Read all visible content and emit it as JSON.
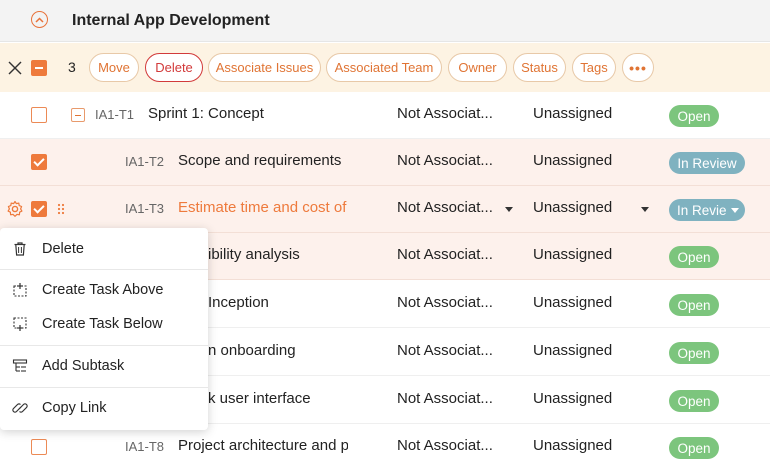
{
  "header": {
    "title": "Internal App Development"
  },
  "toolbar": {
    "selected_count": "3",
    "buttons": {
      "move": "Move",
      "delete": "Delete",
      "associate_issues": "Associate Issues",
      "associated_team": "Associated Team",
      "owner": "Owner",
      "status": "Status",
      "tags": "Tags",
      "more": "•••"
    }
  },
  "rows": [
    {
      "id": "IA1-T1",
      "name": "Sprint 1: Concept",
      "team": "Not Associat...",
      "owner": "Unassigned",
      "status": "Open",
      "checked": false
    },
    {
      "id": "IA1-T2",
      "name": "Scope and requirements i",
      "team": "Not Associat...",
      "owner": "Unassigned",
      "status": "In Review",
      "checked": true
    },
    {
      "id": "IA1-T3",
      "name": "Estimate time and cost of",
      "team": "Not Associat...",
      "owner": "Unassigned",
      "status": "In Revie",
      "checked": true
    },
    {
      "name": "ibility analysis",
      "team": "Not Associat...",
      "owner": "Unassigned",
      "status": "Open",
      "checked": true
    },
    {
      "name": "Inception",
      "team": "Not Associat...",
      "owner": "Unassigned",
      "status": "Open",
      "checked": false
    },
    {
      "name": "n onboarding",
      "team": "Not Associat...",
      "owner": "Unassigned",
      "status": "Open",
      "checked": false
    },
    {
      "name": "k user interface",
      "team": "Not Associat...",
      "owner": "Unassigned",
      "status": "Open",
      "checked": false
    },
    {
      "id": "IA1-T8",
      "name": "Project architecture and p",
      "team": "Not Associat...",
      "owner": "Unassigned",
      "status": "Open",
      "checked": false
    }
  ],
  "context_menu": {
    "delete": "Delete",
    "create_above": "Create Task Above",
    "create_below": "Create Task Below",
    "add_subtask": "Add Subtask",
    "copy_link": "Copy Link"
  },
  "colors": {
    "accent": "#ee7a3c",
    "open": "#7cc57d",
    "review": "#7fb2c0",
    "danger": "#d23a3a"
  },
  "icons": [
    "collapse-icon",
    "close-icon",
    "gear-icon",
    "drag-handle-icon",
    "trash-icon",
    "create-above-icon",
    "create-below-icon",
    "subtask-icon",
    "link-icon"
  ]
}
